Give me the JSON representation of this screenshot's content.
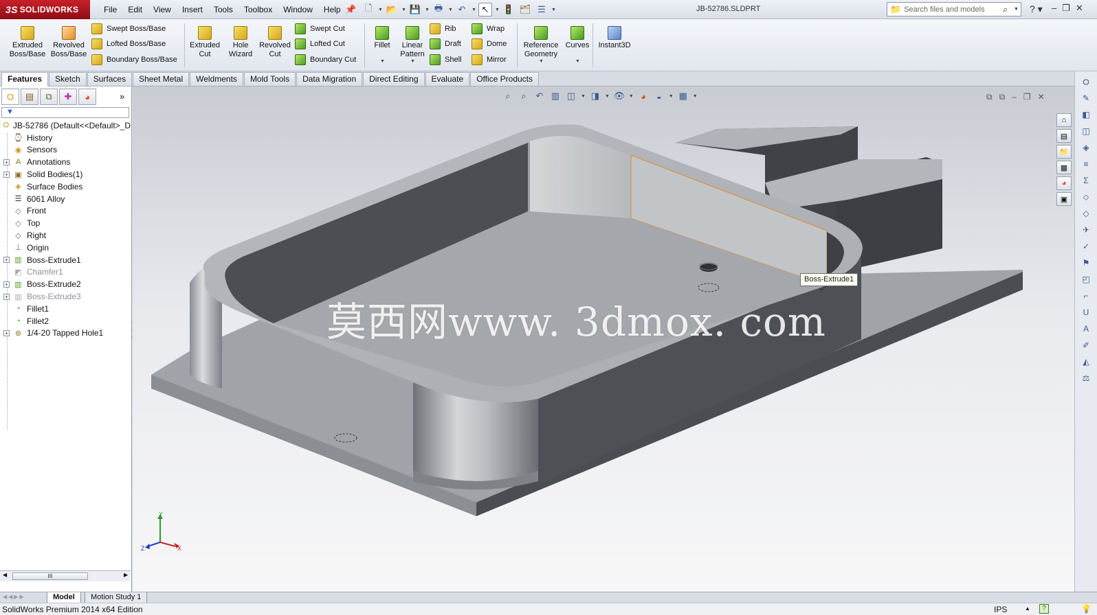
{
  "app": {
    "logo_prefix": "3S",
    "logo_name": "SOLIDWORKS",
    "document_title": "JB-52786.SLDPRT",
    "menu": [
      "File",
      "Edit",
      "View",
      "Insert",
      "Tools",
      "Toolbox",
      "Window",
      "Help"
    ],
    "search_placeholder": "Search files and models"
  },
  "commands": {
    "extruded_boss": "Extruded\nBoss/Base",
    "revolved_boss": "Revolved\nBoss/Base",
    "swept_boss": "Swept Boss/Base",
    "lofted_boss": "Lofted Boss/Base",
    "boundary_boss": "Boundary Boss/Base",
    "extruded_cut": "Extruded\nCut",
    "hole_wizard": "Hole\nWizard",
    "revolved_cut": "Revolved\nCut",
    "swept_cut": "Swept Cut",
    "lofted_cut": "Lofted Cut",
    "boundary_cut": "Boundary Cut",
    "fillet": "Fillet",
    "linear_pattern": "Linear\nPattern",
    "rib": "Rib",
    "draft": "Draft",
    "shell": "Shell",
    "wrap": "Wrap",
    "dome": "Dome",
    "mirror": "Mirror",
    "reference_geometry": "Reference\nGeometry",
    "curves": "Curves",
    "instant3d": "Instant3D"
  },
  "tabs": [
    "Features",
    "Sketch",
    "Surfaces",
    "Sheet Metal",
    "Weldments",
    "Mold Tools",
    "Data Migration",
    "Direct Editing",
    "Evaluate",
    "Office Products"
  ],
  "active_tab": "Features",
  "feature_tree": {
    "root": "JB-52786  (Default<<Default>_D",
    "items": [
      {
        "label": "History",
        "icon": "history-icon",
        "expandable": false,
        "suppressed": false
      },
      {
        "label": "Sensors",
        "icon": "sensor-icon",
        "expandable": false,
        "suppressed": false
      },
      {
        "label": "Annotations",
        "icon": "annotation-icon",
        "expandable": true,
        "suppressed": false
      },
      {
        "label": "Solid Bodies(1)",
        "icon": "solid-bodies-icon",
        "expandable": true,
        "suppressed": false
      },
      {
        "label": "Surface Bodies",
        "icon": "surface-bodies-icon",
        "expandable": false,
        "suppressed": false
      },
      {
        "label": "6061 Alloy",
        "icon": "material-icon",
        "expandable": false,
        "suppressed": false
      },
      {
        "label": "Front",
        "icon": "plane-icon",
        "expandable": false,
        "suppressed": false
      },
      {
        "label": "Top",
        "icon": "plane-icon",
        "expandable": false,
        "suppressed": false
      },
      {
        "label": "Right",
        "icon": "plane-icon",
        "expandable": false,
        "suppressed": false
      },
      {
        "label": "Origin",
        "icon": "origin-icon",
        "expandable": false,
        "suppressed": false
      },
      {
        "label": "Boss-Extrude1",
        "icon": "boss-extrude-icon",
        "expandable": true,
        "suppressed": false
      },
      {
        "label": "Chamfer1",
        "icon": "chamfer-icon",
        "expandable": false,
        "suppressed": true
      },
      {
        "label": "Boss-Extrude2",
        "icon": "boss-extrude-icon",
        "expandable": true,
        "suppressed": false
      },
      {
        "label": "Boss-Extrude3",
        "icon": "boss-extrude-icon",
        "expandable": true,
        "suppressed": true
      },
      {
        "label": "Fillet1",
        "icon": "fillet-icon",
        "expandable": false,
        "suppressed": false
      },
      {
        "label": "Fillet2",
        "icon": "fillet-icon",
        "expandable": false,
        "suppressed": false
      },
      {
        "label": "1/4-20 Tapped Hole1",
        "icon": "hole-icon",
        "expandable": true,
        "suppressed": false
      }
    ]
  },
  "viewport": {
    "tooltip": "Boss-Extrude1",
    "watermark": "莫西网www. 3dmox. com",
    "triad": {
      "x": "X",
      "y": "Y",
      "z": "Z"
    }
  },
  "bottom_tabs": [
    "Model",
    "Motion Study 1"
  ],
  "status": {
    "edition": "SolidWorks Premium 2014 x64 Edition",
    "units": "IPS"
  },
  "colors": {
    "logo_red": "#b5151f",
    "highlight_orange": "#e08a2a",
    "part_gray": "#8f9398"
  }
}
